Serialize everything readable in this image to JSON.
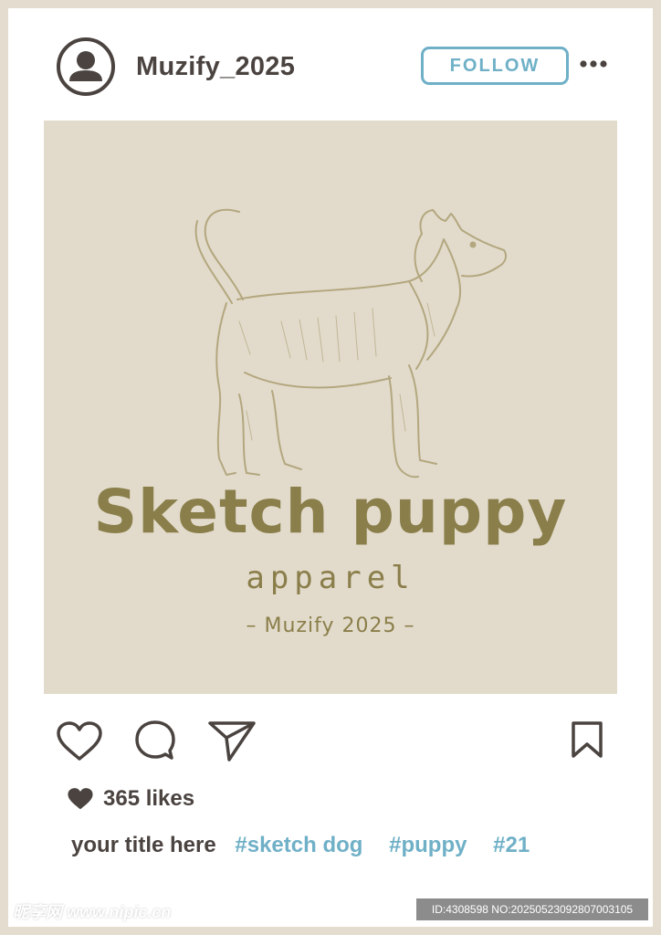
{
  "post": {
    "username": "Muzify_2025",
    "follow_label": "FOLLOW",
    "image": {
      "brand_title": "Sketch puppy",
      "brand_subtitle": "apparel",
      "brand_credit": "– Muzify 2025 –"
    },
    "likes_text": "365 likes",
    "caption": {
      "title": "your title here",
      "tags": [
        "#sketch dog",
        "#puppy",
        "#21"
      ]
    }
  },
  "watermark": {
    "site": "昵享网 www.nipic.cn",
    "id_text": "ID:4308598 NO:20250523092807003105"
  },
  "colors": {
    "accent": "#6fb0c7",
    "text_dark": "#4a4340",
    "frame": "#e4ddcf",
    "image_bg": "#e2dbcb",
    "brand": "#8a7e4a"
  }
}
